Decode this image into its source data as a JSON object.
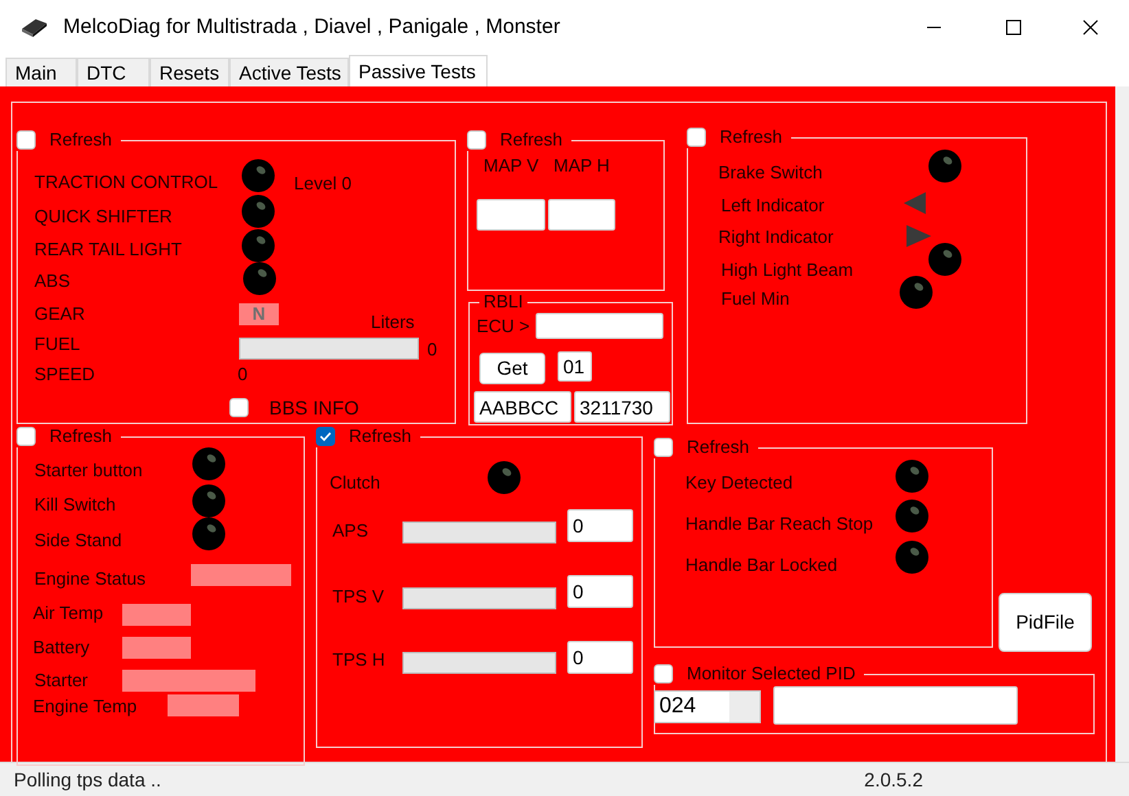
{
  "window": {
    "title": "MelcoDiag for Multistrada , Diavel , Panigale , Monster"
  },
  "tabs": [
    {
      "label": "Main",
      "selected": false
    },
    {
      "label": "DTC",
      "selected": false
    },
    {
      "label": "Resets",
      "selected": false
    },
    {
      "label": "Active Tests",
      "selected": false
    },
    {
      "label": "Passive Tests",
      "selected": true
    }
  ],
  "rider_panel": {
    "refresh": {
      "label": "Refresh",
      "checked": false
    },
    "lights": [
      {
        "label": "TRACTION CONTROL"
      },
      {
        "label": "QUICK SHIFTER"
      },
      {
        "label": "REAR TAIL LIGHT"
      },
      {
        "label": "ABS"
      }
    ],
    "traction_reading": "Level 0",
    "gear": {
      "label": "GEAR",
      "value": "N"
    },
    "fuel": {
      "label": "FUEL",
      "unit": "Liters",
      "level": 0,
      "reading": "0"
    },
    "speed": {
      "label": "SPEED",
      "reading": "0"
    },
    "bbs_info": {
      "label": "BBS INFO",
      "checked": false
    }
  },
  "map_panel": {
    "refresh": {
      "label": "Refresh",
      "checked": false
    },
    "map_v_label": "MAP V",
    "map_h_label": "MAP H"
  },
  "rbli_panel": {
    "title": "RBLI",
    "ecu_label": "ECU >",
    "get_button": "Get",
    "index": "01",
    "code": "AABBCC",
    "number": "3211730"
  },
  "lights_panel": {
    "refresh": {
      "label": "Refresh",
      "checked": false
    },
    "lights": [
      {
        "label": "Brake Switch",
        "kind": "led"
      },
      {
        "label": "Left Indicator",
        "kind": "left-arrow"
      },
      {
        "label": "Right Indicator",
        "kind": "right-arrow"
      },
      {
        "label": "High Light Beam",
        "kind": "led"
      },
      {
        "label": "Fuel Min",
        "kind": "led"
      }
    ]
  },
  "engine_panel": {
    "refresh": {
      "label": "Refresh",
      "checked": false
    },
    "switches": [
      {
        "label": "Starter button"
      },
      {
        "label": "Kill Switch"
      },
      {
        "label": "Side Stand"
      }
    ],
    "readouts": [
      {
        "label": "Engine Status"
      },
      {
        "label": "Air Temp"
      },
      {
        "label": "Battery"
      },
      {
        "label": "Starter"
      },
      {
        "label": "Engine Temp"
      }
    ]
  },
  "throttle_panel": {
    "refresh": {
      "label": "Refresh",
      "checked": true
    },
    "clutch": {
      "label": "Clutch"
    },
    "sensors": [
      {
        "label": "APS",
        "level": 0,
        "value": "0"
      },
      {
        "label": "TPS V",
        "level": 0,
        "value": "0"
      },
      {
        "label": "TPS H",
        "level": 0,
        "value": "0"
      }
    ]
  },
  "key_panel": {
    "refresh": {
      "label": "Refresh",
      "checked": false
    },
    "lights": [
      {
        "label": "Key Detected"
      },
      {
        "label": "Handle Bar Reach Stop"
      },
      {
        "label": "Handle Bar Locked"
      }
    ]
  },
  "pid_file_button": "PidFile",
  "monitor": {
    "label": "Monitor Selected PID",
    "checked": false,
    "pid": "024"
  },
  "status_bar": {
    "message": "Polling tps data ..",
    "version": "2.0.5.2"
  }
}
